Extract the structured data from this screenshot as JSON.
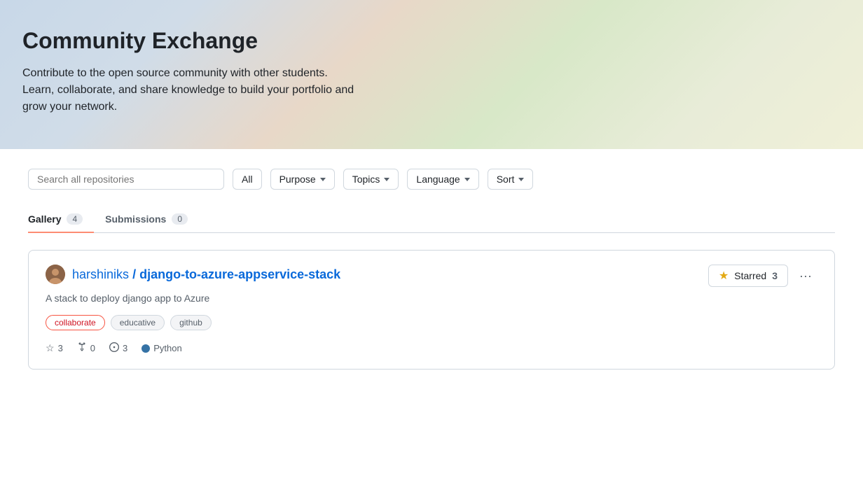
{
  "hero": {
    "title": "Community Exchange",
    "description": "Contribute to the open source community with other students. Learn, collaborate, and share knowledge to build your portfolio and grow your network."
  },
  "filters": {
    "search_placeholder": "Search all repositories",
    "all_label": "All",
    "purpose_label": "Purpose",
    "topics_label": "Topics",
    "language_label": "Language",
    "sort_label": "Sort"
  },
  "tabs": [
    {
      "label": "Gallery",
      "count": "4",
      "active": true
    },
    {
      "label": "Submissions",
      "count": "0",
      "active": false
    }
  ],
  "repositories": [
    {
      "owner": "harshiniks",
      "name": "django-to-azure-appservice-stack",
      "description": "A stack to deploy django app to Azure",
      "starred": true,
      "star_count": 3,
      "forks": 0,
      "issues": 3,
      "language": "Python",
      "language_color": "#3572A5",
      "tags": [
        {
          "label": "collaborate",
          "style": "collaborate"
        },
        {
          "label": "educative",
          "style": "educative"
        },
        {
          "label": "github",
          "style": "github"
        }
      ],
      "starred_button_label": "Starred",
      "starred_count": 3
    }
  ]
}
